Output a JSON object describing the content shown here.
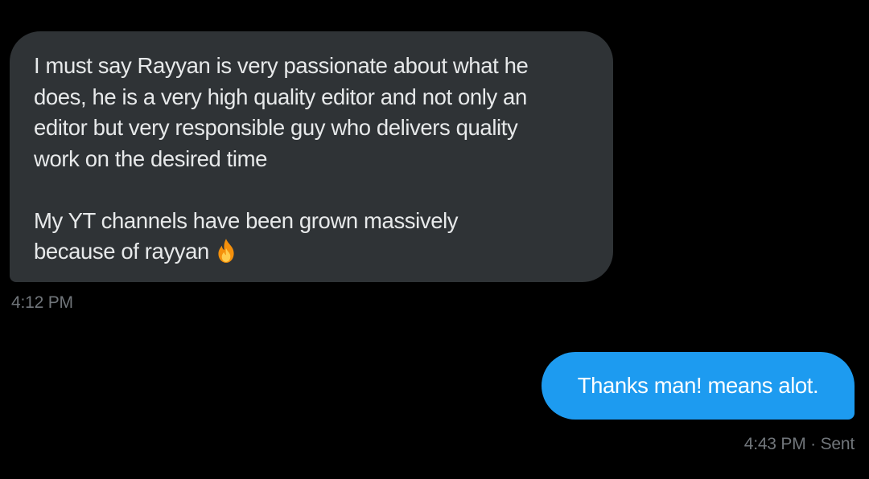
{
  "received_message": {
    "lines": [
      "I must say Rayyan is very passionate about what he",
      "does, he is a very high quality editor and not only an",
      "editor but very responsible guy who delivers quality",
      "work on the desired time",
      "",
      "My YT channels have been grown massively",
      "because of rayyan"
    ],
    "emoji_icon": "fire-icon",
    "timestamp": "4:12 PM",
    "bubble_color": "#2f3336"
  },
  "sent_message": {
    "text": "Thanks man! means alot.",
    "timestamp": "4:43 PM · Sent",
    "bubble_color": "#1d9bf0"
  }
}
